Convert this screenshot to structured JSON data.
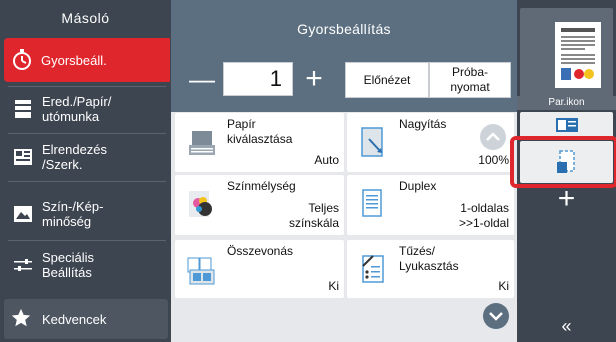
{
  "sidebar": {
    "title": "Másoló",
    "items": [
      {
        "label": "Gyorsbeáll.",
        "icon": "stopwatch-icon"
      },
      {
        "label1": "Ered./Papír/",
        "label2": "utómunka",
        "icon": "paper-output-icon"
      },
      {
        "label1": "Elrendezés",
        "label2": "/Szerk.",
        "icon": "layout-icon"
      },
      {
        "label1": "Szín-/Kép-",
        "label2": "minőség",
        "icon": "image-quality-icon"
      },
      {
        "label1": "Speciális",
        "label2": "Beállítás",
        "icon": "sliders-icon"
      }
    ],
    "favorites": {
      "label": "Kedvencek",
      "icon": "star-icon"
    }
  },
  "main": {
    "title": "Gyorsbeállítás",
    "quantity": "1",
    "minus": "—",
    "plus": "+",
    "preview_label": "Előnézet",
    "test_copy_line1": "Próba-",
    "test_copy_line2": "nyomat",
    "cards": [
      {
        "l1": "Papír",
        "l2": "kiválasztása",
        "v1": "Auto",
        "v2": "",
        "icon": "paper-tray-icon"
      },
      {
        "l1": "Nagyítás",
        "l2": "",
        "v1": "100%",
        "v2": "",
        "icon": "zoom-icon"
      },
      {
        "l1": "Színmélység",
        "l2": "",
        "v1": "Teljes",
        "v2": "színskála",
        "icon": "color-icon"
      },
      {
        "l1": "Duplex",
        "l2": "",
        "v1": "1-oldalas",
        "v2": ">>1-oldal",
        "icon": "duplex-icon"
      },
      {
        "l1": "Összevonás",
        "l2": "",
        "v1": "Ki",
        "v2": "",
        "icon": "combine-icon"
      },
      {
        "l1": "Tűzés/",
        "l2": "Lyukasztás",
        "v1": "Ki",
        "v2": "",
        "icon": "staple-punch-icon"
      }
    ]
  },
  "right": {
    "preview_label": "Par.ikon",
    "plus": "+",
    "collapse": "«"
  },
  "colors": {
    "accent": "#e0262d",
    "sidebar": "#3d4550",
    "header": "#5c6f80"
  }
}
